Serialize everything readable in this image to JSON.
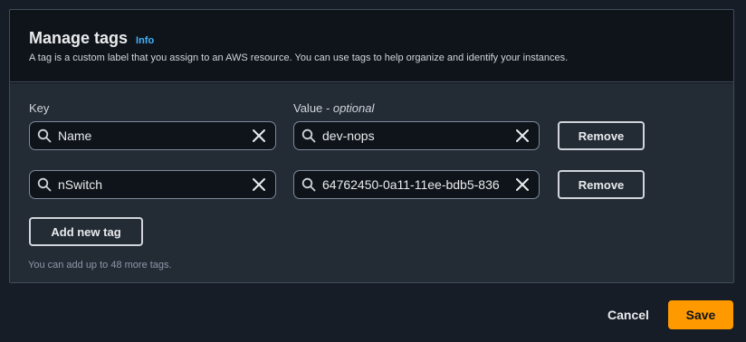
{
  "header": {
    "title": "Manage tags",
    "info_label": "Info",
    "description": "A tag is a custom label that you assign to an AWS resource. You can use tags to help organize and identify your instances."
  },
  "columns": {
    "key_label": "Key",
    "value_label": "Value",
    "value_optional": " - optional"
  },
  "tags": [
    {
      "key": "Name",
      "value": "dev-nops",
      "remove_label": "Remove"
    },
    {
      "key": "nSwitch",
      "value": "64762450-0a11-11ee-bdb5-836",
      "remove_label": "Remove"
    }
  ],
  "add_button_label": "Add new tag",
  "hint": "You can add up to 48 more tags.",
  "footer": {
    "cancel_label": "Cancel",
    "save_label": "Save"
  },
  "colors": {
    "accent": "#ff9900",
    "link": "#42b4ff",
    "background": "#161d26",
    "panel": "#0f141a"
  },
  "icons": {
    "search": "search-icon",
    "clear": "close-icon"
  }
}
